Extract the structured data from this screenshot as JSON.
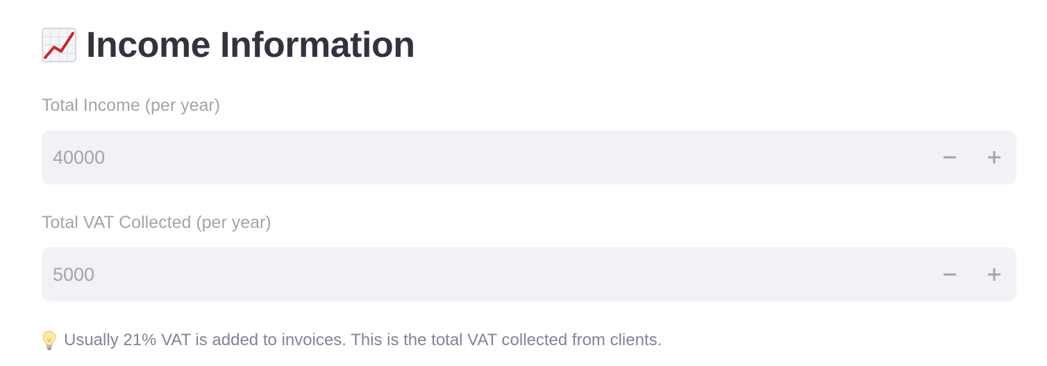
{
  "section": {
    "icon": "chart-increasing-icon",
    "title": "Income Information"
  },
  "fields": {
    "total_income": {
      "label": "Total Income (per year)",
      "value": "40000"
    },
    "total_vat": {
      "label": "Total VAT Collected (per year)",
      "value": "5000"
    }
  },
  "caption": {
    "icon": "light-bulb-icon",
    "text": "Usually 21% VAT is added to invoices. This is the total VAT collected from clients."
  },
  "colors": {
    "input_background": "#f0f2f6",
    "muted_text": "#a3a4ab",
    "heading_text": "#31333f",
    "caption_text": "#808495"
  }
}
